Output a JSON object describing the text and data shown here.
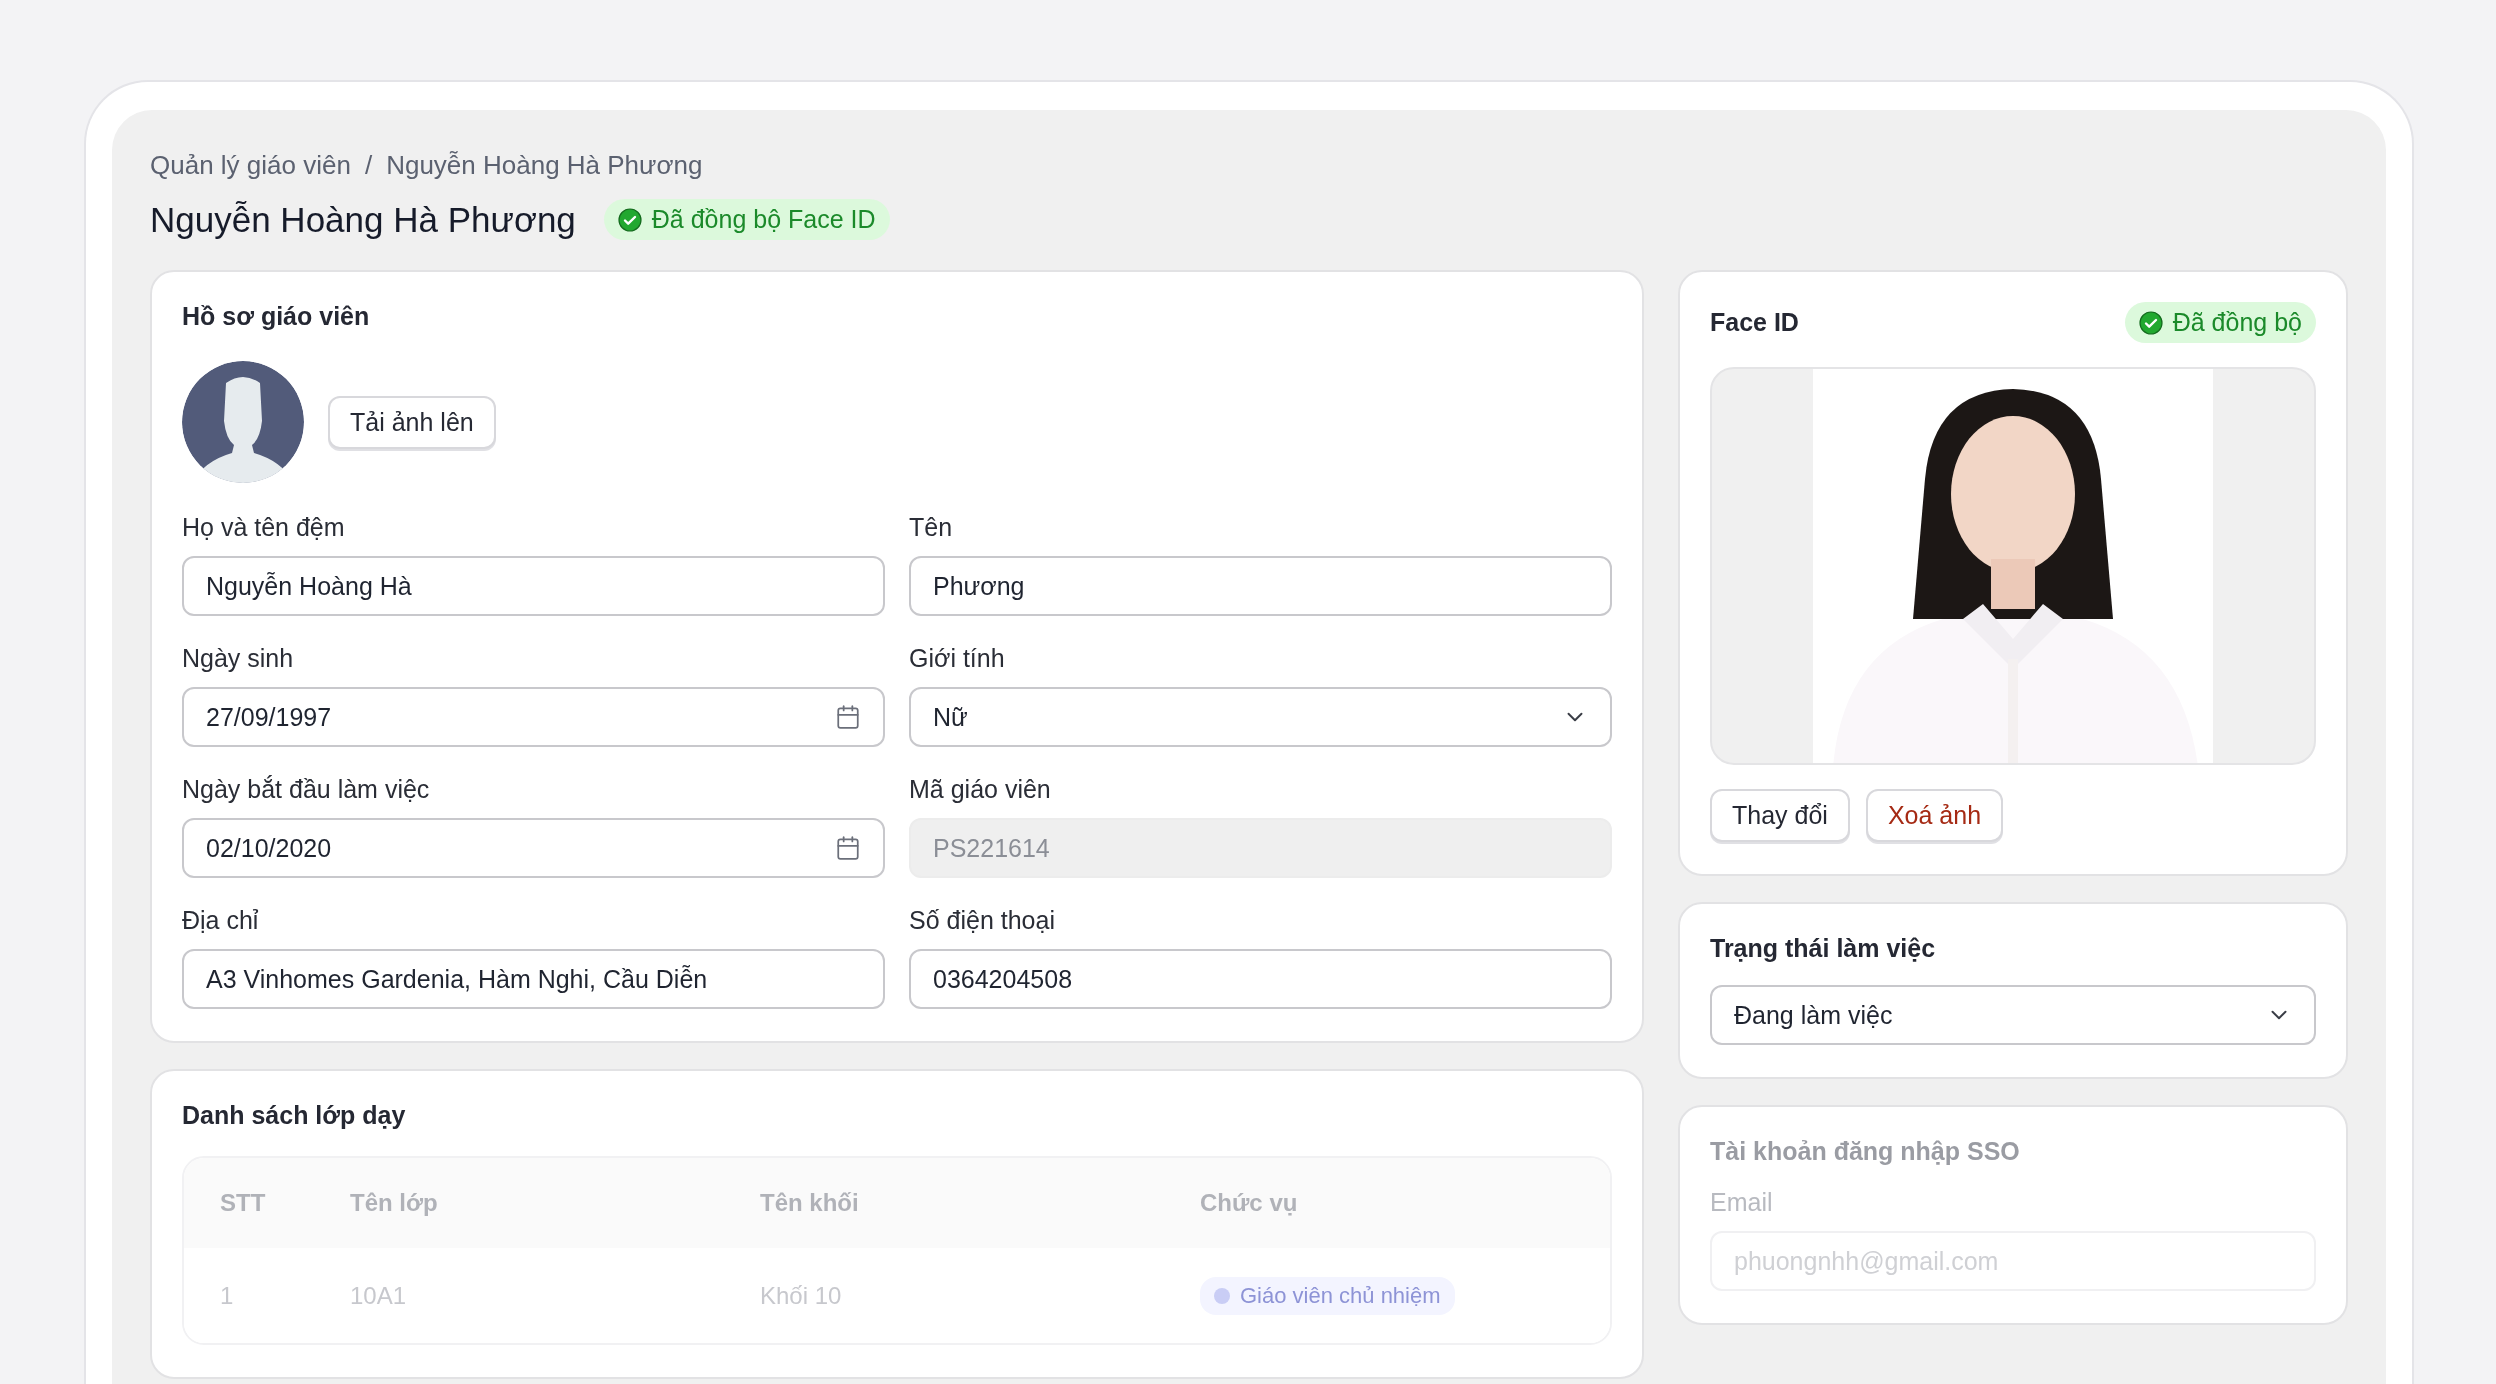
{
  "breadcrumb": {
    "items": [
      {
        "label": "Quản lý giáo viên"
      },
      {
        "label": "Nguyễn Hoàng Hà Phương"
      }
    ],
    "separator": "/"
  },
  "title": "Nguyễn Hoàng Hà Phương",
  "sync_badge": {
    "label": "Đã đồng bộ Face ID",
    "kind": "success"
  },
  "profile": {
    "title": "Hồ sơ giáo viên",
    "upload_button": "Tải ảnh lên",
    "fields": [
      {
        "label": "Họ và tên đệm",
        "value": "Nguyễn Hoàng Hà",
        "kind": "text",
        "disabled": false
      },
      {
        "label": "Tên",
        "value": "Phương",
        "kind": "text",
        "disabled": false
      },
      {
        "label": "Ngày sinh",
        "value": "27/09/1997",
        "kind": "date",
        "disabled": false
      },
      {
        "label": "Giới tính",
        "value": "Nữ",
        "kind": "select",
        "disabled": false
      },
      {
        "label": "Ngày bắt đầu làm việc",
        "value": "02/10/2020",
        "kind": "date",
        "disabled": false
      },
      {
        "label": "Mã giáo viên",
        "value": "PS221614",
        "kind": "text",
        "disabled": true
      },
      {
        "label": "Địa chỉ",
        "value": "A3 Vinhomes Gardenia, Hàm Nghi, Cầu Diễn",
        "kind": "text",
        "disabled": false
      },
      {
        "label": "Số điện thoại",
        "value": "0364204508",
        "kind": "text",
        "disabled": false
      }
    ]
  },
  "classes": {
    "title": "Danh sách lớp dạy",
    "columns": [
      "STT",
      "Tên lớp",
      "Tên khối",
      "Chức vụ"
    ],
    "rows": [
      {
        "cells": [
          "1",
          "10A1",
          "Khối 10"
        ],
        "role": "Giáo viên chủ nhiệm"
      }
    ]
  },
  "face_id": {
    "title": "Face ID",
    "badge": {
      "label": "Đã đồng bộ",
      "kind": "success"
    },
    "buttons": [
      {
        "label": "Thay đổi",
        "kind": "default"
      },
      {
        "label": "Xoá ảnh",
        "kind": "danger"
      }
    ]
  },
  "work_status": {
    "title": "Trạng thái làm việc",
    "value": "Đang làm việc"
  },
  "sso": {
    "title": "Tài khoản đăng nhập SSO",
    "email_label": "Email",
    "email_placeholder": "phuongnhh@gmail.com"
  }
}
